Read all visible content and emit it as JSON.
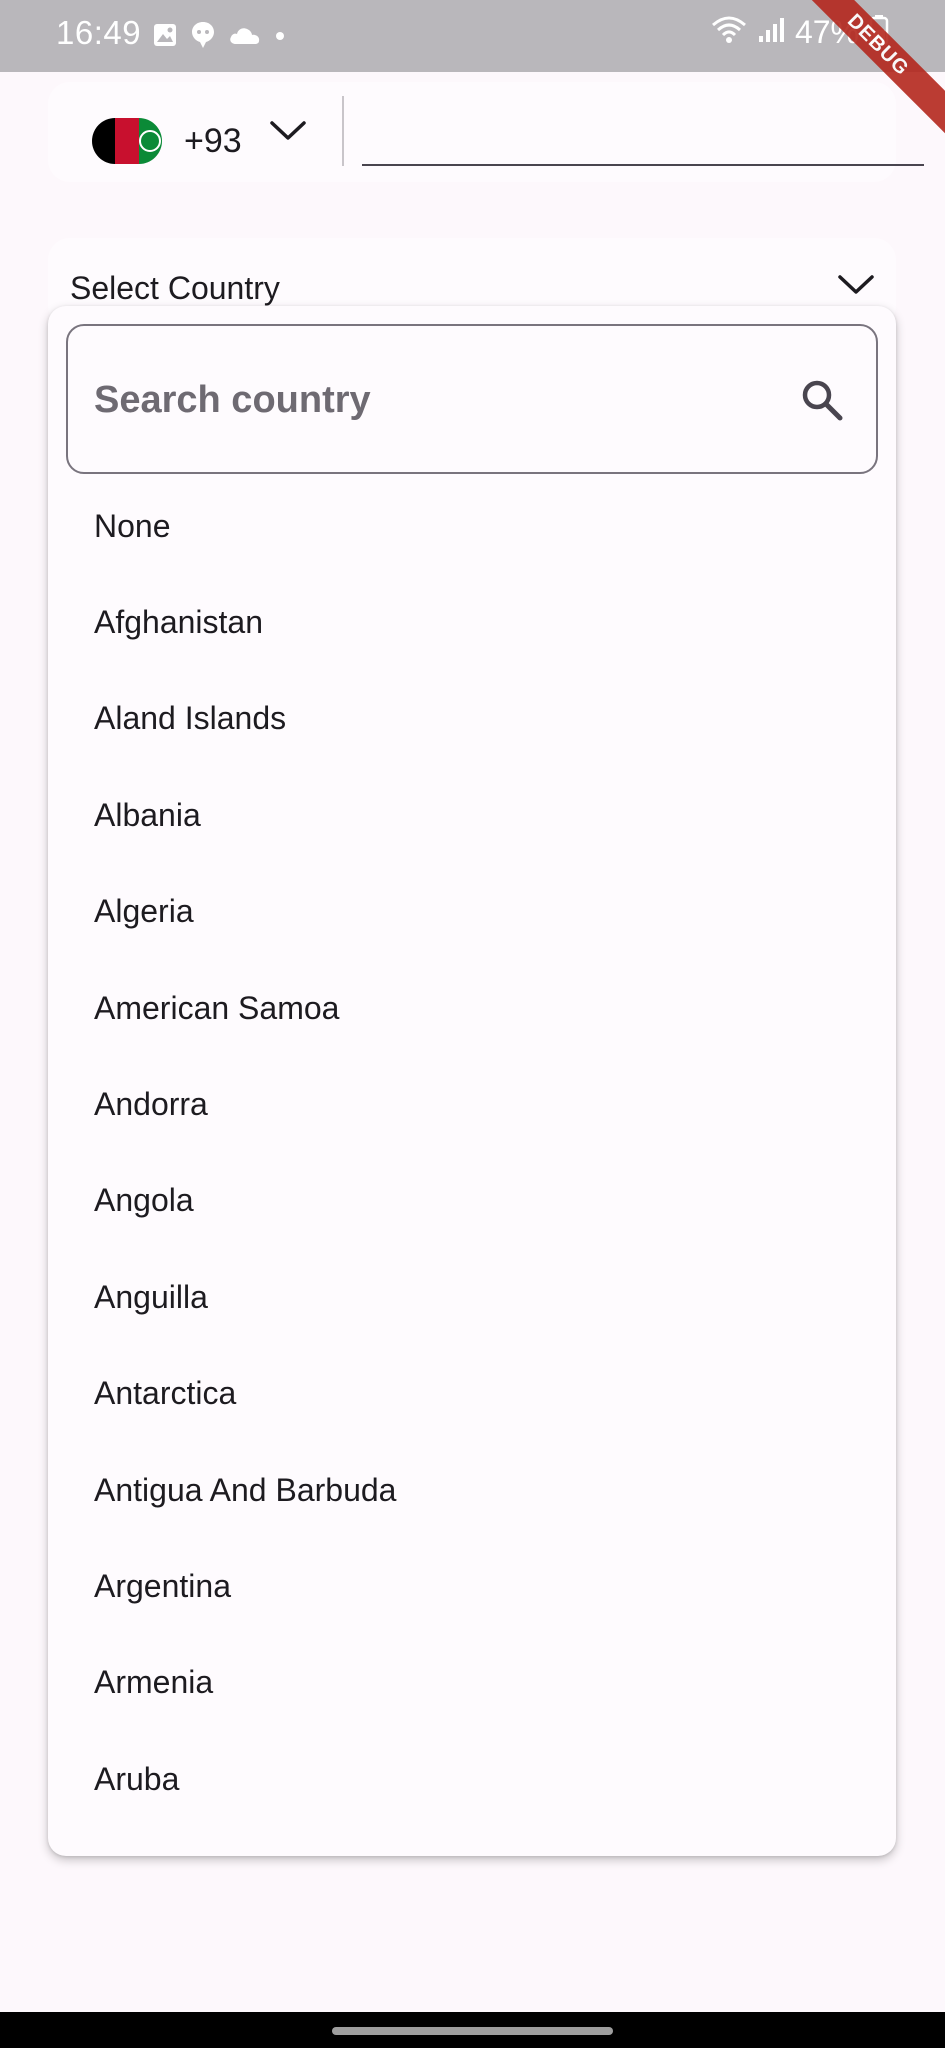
{
  "status_bar": {
    "time": "16:49",
    "battery": "47%",
    "left_icons": [
      "image-icon",
      "chat-icon",
      "cloud-icon",
      "dot-icon"
    ],
    "right_icons": [
      "wifi-icon",
      "signal-icon",
      "battery-icon"
    ]
  },
  "debug_banner": "DEBUG",
  "phone": {
    "flag": "afghanistan-flag-icon",
    "dial_code": "+93",
    "number_value": ""
  },
  "country_select": {
    "label": "Select Country"
  },
  "search": {
    "placeholder": "Search country",
    "value": ""
  },
  "countries": [
    "None",
    "Afghanistan",
    "Aland Islands",
    "Albania",
    "Algeria",
    "American Samoa",
    "Andorra",
    "Angola",
    "Anguilla",
    "Antarctica",
    "Antigua And Barbuda",
    "Argentina",
    "Armenia",
    "Aruba"
  ],
  "colors": {
    "background": "#fdf8fc",
    "status_bar": "#b9b7bb",
    "debug_banner": "#b4281e",
    "text": "#1d1b20"
  }
}
